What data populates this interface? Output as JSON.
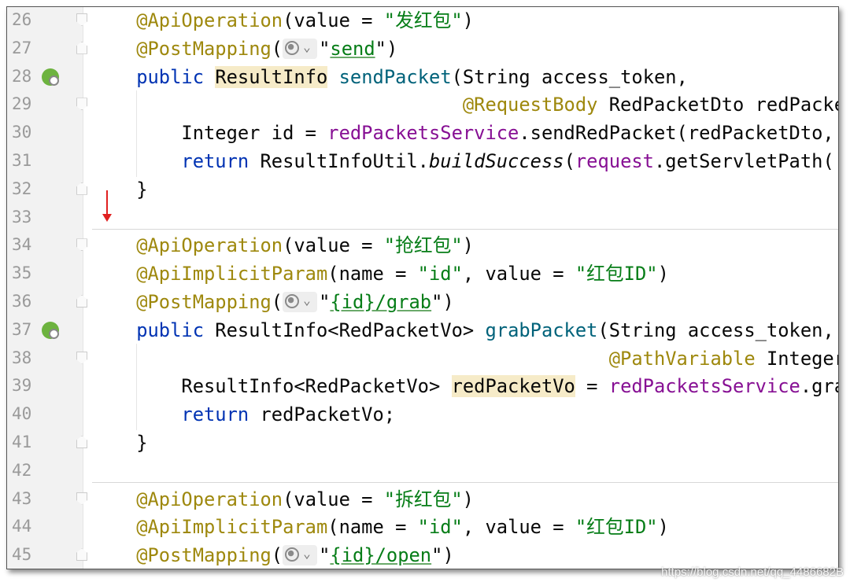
{
  "editor": {
    "lines": [
      {
        "n": "26",
        "fold": "down",
        "segs": [
          [
            "    ",
            ""
          ],
          [
            "@ApiOperation",
            "ann"
          ],
          [
            "(value = ",
            ""
          ],
          [
            "\"发红包\"",
            "str"
          ],
          [
            ")",
            ""
          ]
        ]
      },
      {
        "n": "27",
        "fold": "up",
        "segs": [
          [
            "    ",
            ""
          ],
          [
            "@PostMapping",
            "ann"
          ],
          [
            "(",
            ""
          ],
          [
            "",
            "globe"
          ],
          [
            "\"",
            ""
          ],
          [
            "send",
            "str lnk"
          ],
          [
            "\"",
            ""
          ],
          [
            ")",
            ""
          ]
        ]
      },
      {
        "n": "28",
        "icon": "spring",
        "segs": [
          [
            "    ",
            ""
          ],
          [
            "public",
            "kw"
          ],
          [
            " ",
            ""
          ],
          [
            "ResultInfo",
            "hl"
          ],
          [
            " ",
            ""
          ],
          [
            "sendPacket",
            "fn"
          ],
          [
            "(String access_token,",
            ""
          ]
        ]
      },
      {
        "n": "29",
        "fold": "down",
        "segs": [
          [
            "                                 ",
            ""
          ],
          [
            "@RequestBody",
            "ann"
          ],
          [
            " RedPacketDto redPacketDto,",
            ""
          ]
        ]
      },
      {
        "n": "30",
        "segs": [
          [
            "        Integer id = ",
            ""
          ],
          [
            "redPacketsService",
            "fld"
          ],
          [
            ".sendRedPacket(redPacketDto, ",
            ""
          ]
        ]
      },
      {
        "n": "31",
        "segs": [
          [
            "        ",
            ""
          ],
          [
            "return",
            "kw"
          ],
          [
            " ResultInfoUtil.",
            ""
          ],
          [
            "buildSuccess",
            "it"
          ],
          [
            "(",
            ""
          ],
          [
            "request",
            "fld"
          ],
          [
            ".getServletPath(",
            ""
          ]
        ]
      },
      {
        "n": "32",
        "fold": "up",
        "segs": [
          [
            "    }",
            ""
          ]
        ]
      },
      {
        "n": "33",
        "segs": []
      },
      {
        "n": "34",
        "fold": "down",
        "segs": [
          [
            "    ",
            ""
          ],
          [
            "@ApiOperation",
            "ann"
          ],
          [
            "(value = ",
            ""
          ],
          [
            "\"抢红包\"",
            "str"
          ],
          [
            ")",
            ""
          ]
        ]
      },
      {
        "n": "35",
        "segs": [
          [
            "    ",
            ""
          ],
          [
            "@ApiImplicitParam",
            "ann"
          ],
          [
            "(name = ",
            ""
          ],
          [
            "\"id\"",
            "str"
          ],
          [
            ", value = ",
            ""
          ],
          [
            "\"红包ID\"",
            "str"
          ],
          [
            ")",
            ""
          ]
        ]
      },
      {
        "n": "36",
        "fold": "up",
        "segs": [
          [
            "    ",
            ""
          ],
          [
            "@PostMapping",
            "ann"
          ],
          [
            "(",
            ""
          ],
          [
            "",
            "globe"
          ],
          [
            "\"",
            ""
          ],
          [
            "{id}/grab",
            "str lnk"
          ],
          [
            "\"",
            ""
          ],
          [
            ")",
            ""
          ]
        ]
      },
      {
        "n": "37",
        "icon": "spring",
        "segs": [
          [
            "    ",
            ""
          ],
          [
            "public",
            "kw"
          ],
          [
            " ResultInfo<RedPacketVo> ",
            ""
          ],
          [
            "grabPacket",
            "fn"
          ],
          [
            "(String access_token,",
            ""
          ]
        ]
      },
      {
        "n": "38",
        "fold": "down",
        "segs": [
          [
            "                                              ",
            ""
          ],
          [
            "@PathVariable",
            "ann"
          ],
          [
            " Integer id",
            ""
          ]
        ]
      },
      {
        "n": "39",
        "segs": [
          [
            "        ResultInfo<RedPacketVo> ",
            ""
          ],
          [
            "redPacketVo",
            "hl"
          ],
          [
            " = ",
            ""
          ],
          [
            "redPacketsService",
            "fld"
          ],
          [
            ".grabRedPacket(",
            ""
          ]
        ]
      },
      {
        "n": "40",
        "segs": [
          [
            "        ",
            ""
          ],
          [
            "return",
            "kw"
          ],
          [
            " redPacketVo;",
            ""
          ]
        ]
      },
      {
        "n": "41",
        "fold": "up",
        "segs": [
          [
            "    }",
            ""
          ]
        ]
      },
      {
        "n": "42",
        "segs": []
      },
      {
        "n": "43",
        "fold": "down",
        "segs": [
          [
            "    ",
            ""
          ],
          [
            "@ApiOperation",
            "ann"
          ],
          [
            "(value = ",
            ""
          ],
          [
            "\"拆红包\"",
            "str"
          ],
          [
            ")",
            ""
          ]
        ]
      },
      {
        "n": "44",
        "segs": [
          [
            "    ",
            ""
          ],
          [
            "@ApiImplicitParam",
            "ann"
          ],
          [
            "(name = ",
            ""
          ],
          [
            "\"id\"",
            "str"
          ],
          [
            ", value = ",
            ""
          ],
          [
            "\"红包ID\"",
            "str"
          ],
          [
            ")",
            ""
          ]
        ]
      },
      {
        "n": "45",
        "fold": "up",
        "segs": [
          [
            "    ",
            ""
          ],
          [
            "@PostMapping",
            "ann"
          ],
          [
            "(",
            ""
          ],
          [
            "",
            "globe"
          ],
          [
            "\"",
            ""
          ],
          [
            "{id}/open",
            "str lnk"
          ],
          [
            "\"",
            ""
          ],
          [
            ")",
            ""
          ]
        ]
      }
    ]
  },
  "watermark": "https://blog.csdn.net/qq_4486682B"
}
